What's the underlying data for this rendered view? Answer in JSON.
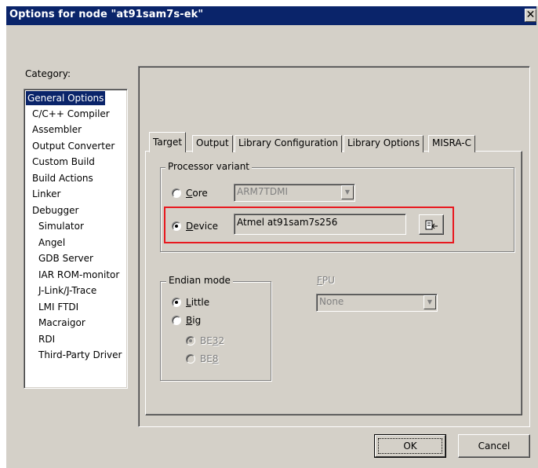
{
  "window": {
    "title": "Options for node \"at91sam7s-ek\"",
    "close_glyph": "✕"
  },
  "category": {
    "label": "Category:",
    "items": [
      {
        "label": "General Options",
        "selected": true
      },
      {
        "label": "C/C++ Compiler"
      },
      {
        "label": "Assembler"
      },
      {
        "label": "Output Converter"
      },
      {
        "label": "Custom Build"
      },
      {
        "label": "Build Actions"
      },
      {
        "label": "Linker"
      },
      {
        "label": "Debugger"
      },
      {
        "label": "Simulator"
      },
      {
        "label": "Angel"
      },
      {
        "label": "GDB Server"
      },
      {
        "label": "IAR ROM-monitor"
      },
      {
        "label": "J-Link/J-Trace"
      },
      {
        "label": "LMI FTDI"
      },
      {
        "label": "Macraigor"
      },
      {
        "label": "RDI"
      },
      {
        "label": "Third-Party Driver"
      }
    ]
  },
  "tabs": [
    {
      "label": "Target",
      "active": true
    },
    {
      "label": "Output"
    },
    {
      "label": "Library Configuration"
    },
    {
      "label": "Library Options"
    },
    {
      "label": "MISRA-C"
    }
  ],
  "processor": {
    "group_title": "Processor variant",
    "core_label_u": "C",
    "core_label_rest": "ore",
    "core_value": "ARM7TDMI",
    "device_label_u": "D",
    "device_label_rest": "evice",
    "device_value": "Atmel at91sam7s256",
    "selected": "Device",
    "device_button_icon": "select-device-icon"
  },
  "endian": {
    "group_title": "Endian mode",
    "little_u": "L",
    "little_rest": "ittle",
    "big_u": "B",
    "big_rest": "ig",
    "be32_pre": "BE",
    "be32_u": "3",
    "be32_post": "2",
    "be8_pre": "BE",
    "be8_u": "8",
    "selected": "Little"
  },
  "fpu": {
    "label_u": "F",
    "label_rest": "PU",
    "value": "None"
  },
  "buttons": {
    "ok": "OK",
    "cancel": "Cancel"
  },
  "colors": {
    "titlebar": "#0a246a",
    "selection": "#0a246a",
    "highlight_box": "#e8181f",
    "face": "#d4d0c8"
  }
}
